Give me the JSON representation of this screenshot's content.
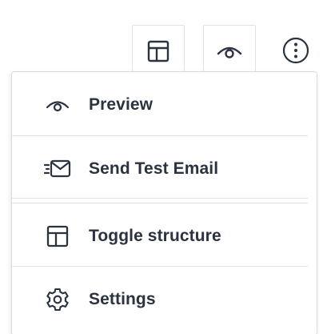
{
  "toolbar": {
    "layout_icon": "layout-icon",
    "preview_icon": "eye-icon",
    "more_icon": "more-vertical-icon"
  },
  "menu": {
    "items": [
      {
        "label": "Preview",
        "icon": "eye-icon"
      },
      {
        "label": "Send Test Email",
        "icon": "send-mail-icon"
      },
      {
        "label": "Toggle structure",
        "icon": "layout-icon"
      },
      {
        "label": "Settings",
        "icon": "gear-icon"
      }
    ]
  },
  "colors": {
    "text": "#2b3240",
    "icon": "#2b3240",
    "border": "#dfe3e8"
  }
}
